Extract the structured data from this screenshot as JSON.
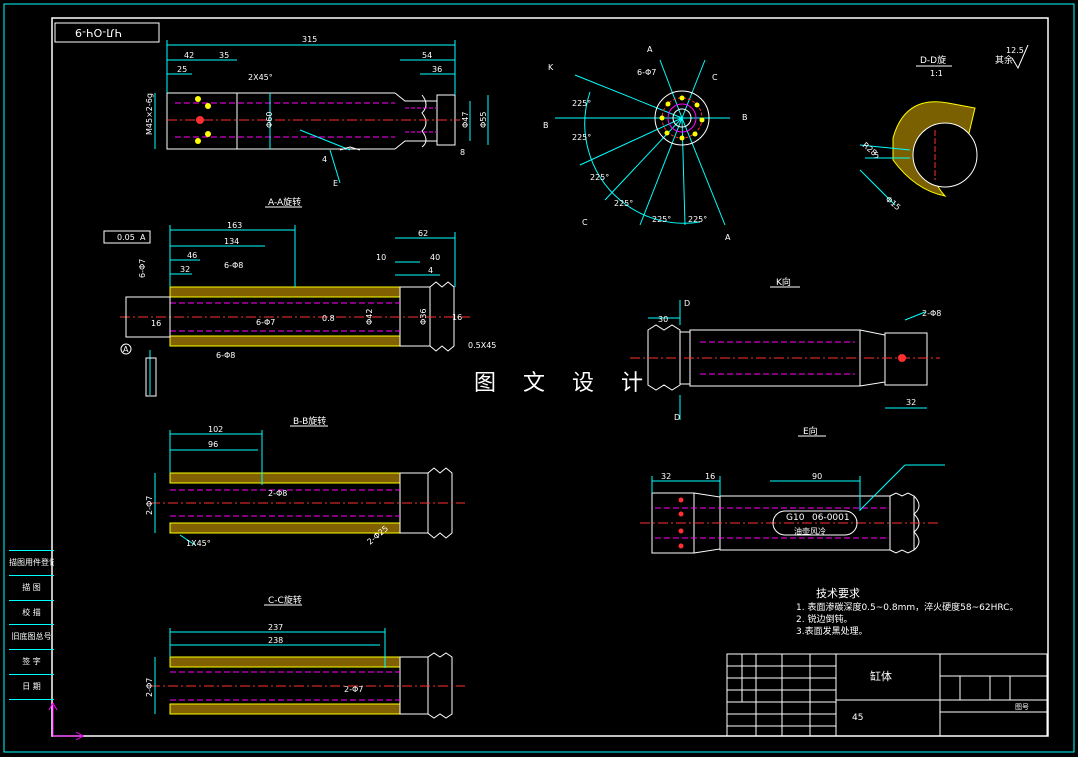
{
  "drawing_code": "ЧЛ-ОЧ-9",
  "watermark": "图 文 设 计",
  "views": {
    "aa": "A-A旋转",
    "bb": "B-B旋转",
    "cc": "C-C旋转",
    "dd": "D-D旋",
    "dd_scale": "1:1",
    "k": "K向",
    "e": "E向"
  },
  "surface_note": "其余",
  "roughness": "12.5",
  "dimensions": {
    "main": [
      "315",
      "42",
      "35",
      "25",
      "54",
      "36",
      "2X45°",
      "M45×2-6g",
      "Φ60",
      "Φ47",
      "Φ55",
      "8",
      "4",
      "E"
    ],
    "aa": [
      "163",
      "134",
      "46",
      "32",
      "62",
      "10",
      "40",
      "4",
      "6-Φ7",
      "6-Φ8",
      "0.8",
      "Φ42",
      "Φ36",
      "16",
      "0.5X45",
      "0.05",
      "A"
    ],
    "bb": [
      "102",
      "96",
      "2-Φ7",
      "2-Φ8",
      "1X45°",
      "2-Φ25"
    ],
    "cc": [
      "237",
      "238",
      "2-Φ7",
      "2-Φ7"
    ],
    "k": [
      "30",
      "32",
      "D",
      "D",
      "2-Φ8"
    ],
    "e": [
      "32",
      "16",
      "90",
      "G10",
      "06-0001",
      "油壶风冷"
    ],
    "top": [
      "225°",
      "225°",
      "225°",
      "225°",
      "225°",
      "225°",
      "6-Φ7",
      "A",
      "A",
      "B",
      "B",
      "C",
      "C",
      "K"
    ],
    "dd": [
      "R28",
      "5",
      "Φ15"
    ]
  },
  "tech_requirements": {
    "title": "技术要求",
    "items": [
      "1. 表面渗碳深度0.5~0.8mm，淬火硬度58~62HRC。",
      "2. 锐边倒钝。",
      "3.表面发黑处理。"
    ]
  },
  "side_table": [
    "描图用件登记",
    "描 图",
    "校 描",
    "旧底图总号",
    "签 字",
    "日 期"
  ],
  "title_block": {
    "part_name": "缸体",
    "material": "45",
    "drawing_no": "图号"
  }
}
